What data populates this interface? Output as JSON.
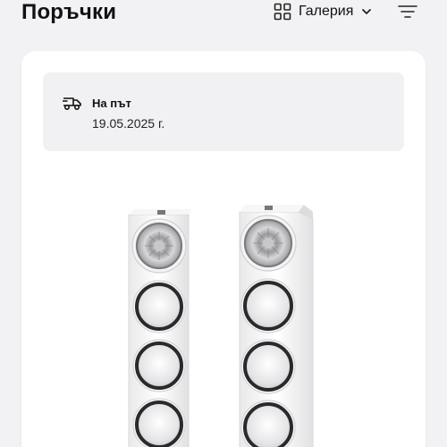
{
  "header": {
    "title": "Поръчки",
    "view_label": "Галерия",
    "view_icon": "grid-icon",
    "filter_icon": "filter-icon"
  },
  "order": {
    "status_icon": "delivery-truck-icon",
    "status": "На път",
    "date": "19.05.2025 г."
  },
  "colors": {
    "background": "#f2f2f4",
    "card": "#ffffff",
    "status_box": "#f1f1f3",
    "text": "#111111"
  }
}
